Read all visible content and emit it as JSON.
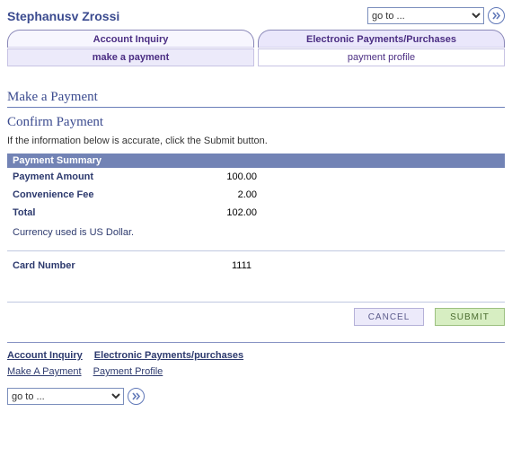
{
  "header": {
    "user_name": "Stephanusv Zrossi",
    "goto_label": "go to ..."
  },
  "tabs": {
    "primary": [
      {
        "label": "Account Inquiry",
        "active": false
      },
      {
        "label": "Electronic Payments/Purchases",
        "active": true
      }
    ],
    "secondary": [
      {
        "label": "make a payment",
        "active": true
      },
      {
        "label": "payment profile",
        "active": false
      }
    ]
  },
  "page": {
    "title": "Make a Payment",
    "section_title": "Confirm Payment",
    "instruction": "If the information below is accurate, click the Submit button."
  },
  "summary": {
    "header": "Payment Summary",
    "rows": [
      {
        "label": "Payment Amount",
        "value": "100.00"
      },
      {
        "label": "Convenience Fee",
        "value": "2.00"
      },
      {
        "label": "Total",
        "value": "102.00"
      }
    ],
    "currency_note": "Currency used is US Dollar.",
    "card_label": "Card Number",
    "card_value": "1111"
  },
  "buttons": {
    "cancel": "CANCEL",
    "submit": "SUBMIT"
  },
  "footer": {
    "row1": [
      "Account Inquiry",
      "Electronic Payments/purchases"
    ],
    "row2": [
      "Make A Payment",
      "Payment Profile"
    ],
    "goto_label": "go to ..."
  }
}
